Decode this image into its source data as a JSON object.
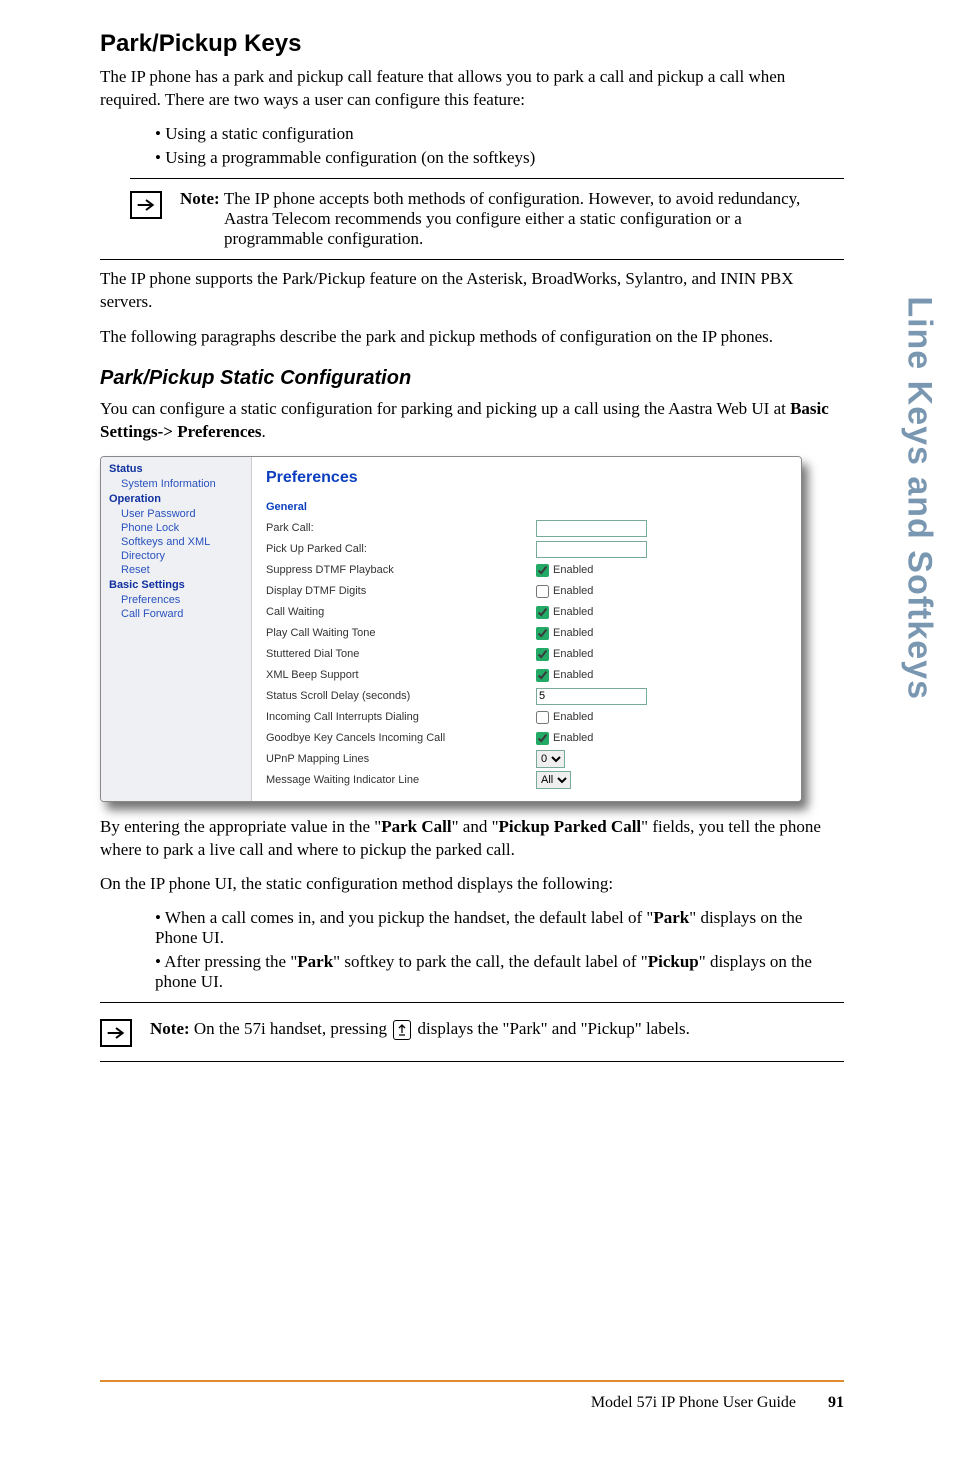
{
  "side_title": "Line Keys and Softkeys",
  "h2": "Park/Pickup Keys",
  "intro": "The IP phone has a park and pickup call feature that allows you to park a call and pickup a call when required. There are two ways a user can configure this feature:",
  "bullets1": [
    "Using a static configuration",
    "Using a programmable configuration (on the softkeys)"
  ],
  "note1_label": "Note: ",
  "note1_body": "The IP phone accepts both methods of configuration. However, to avoid redundancy, Aastra Telecom recommends you configure either a static configuration or a programmable configuration.",
  "para2": "The IP phone supports the Park/Pickup feature on the Asterisk, BroadWorks, Sylantro, and ININ PBX servers.",
  "para3": "The following paragraphs describe the park and pickup methods of configuration on the IP phones.",
  "h3": "Park/Pickup Static Configuration",
  "para4_a": "You can configure a static configuration for parking and picking up a call using the Aastra Web UI at ",
  "para4_b": "Basic Settings-> Preferences",
  "para4_c": ".",
  "webui": {
    "nav_groups": [
      {
        "label": "Status",
        "items": [
          "System Information"
        ]
      },
      {
        "label": "Operation",
        "items": [
          "User Password",
          "Phone Lock",
          "Softkeys and XML",
          "Directory",
          "Reset"
        ]
      },
      {
        "label": "Basic Settings",
        "items": [
          "Preferences",
          "Call Forward"
        ]
      }
    ],
    "title": "Preferences",
    "section": "General",
    "rows": {
      "park_call": {
        "label": "Park Call:",
        "value": ""
      },
      "pickup_parked": {
        "label": "Pick Up Parked Call:",
        "value": ""
      },
      "suppress_dtmf": {
        "label": "Suppress DTMF Playback",
        "checked": true,
        "text": "Enabled"
      },
      "display_dtmf": {
        "label": "Display DTMF Digits",
        "checked": false,
        "text": "Enabled"
      },
      "call_waiting": {
        "label": "Call Waiting",
        "checked": true,
        "text": "Enabled"
      },
      "play_cw_tone": {
        "label": "Play Call Waiting Tone",
        "checked": true,
        "text": "Enabled"
      },
      "stuttered": {
        "label": "Stuttered Dial Tone",
        "checked": true,
        "text": "Enabled"
      },
      "xml_beep": {
        "label": "XML Beep Support",
        "checked": true,
        "text": "Enabled"
      },
      "scroll_delay": {
        "label": "Status Scroll Delay (seconds)",
        "value": "5"
      },
      "inc_interrupts": {
        "label": "Incoming Call Interrupts Dialing",
        "checked": false,
        "text": "Enabled"
      },
      "goodbye": {
        "label": "Goodbye Key Cancels Incoming Call",
        "checked": true,
        "text": "Enabled"
      },
      "upnp": {
        "label": "UPnP Mapping Lines",
        "value": "0"
      },
      "mwi": {
        "label": "Message Waiting Indicator Line",
        "value": "All"
      }
    }
  },
  "para5_parts": [
    "By entering the appropriate value in the \"",
    "Park Call",
    "\" and \"",
    "Pickup Parked Call",
    "\" fields, you tell the phone where to park a live call and where to pickup the parked call."
  ],
  "para6": "On the IP phone UI, the static configuration method displays the following:",
  "bullets2_item1": [
    "When a call comes in, and you pickup the handset, the default label of \"",
    "Park",
    "\" displays on the Phone UI."
  ],
  "bullets2_item2": [
    "After pressing the \"",
    "Park",
    "\" softkey to park the call, the default label of \"",
    "Pickup",
    "\" displays on the phone UI."
  ],
  "note2_label": "Note: ",
  "note2_a": "On the 57i handset, pressing ",
  "note2_b": " displays the \"Park\" and \"Pickup\" labels.",
  "footer_text": "Model 57i IP Phone User Guide",
  "footer_page": "91"
}
